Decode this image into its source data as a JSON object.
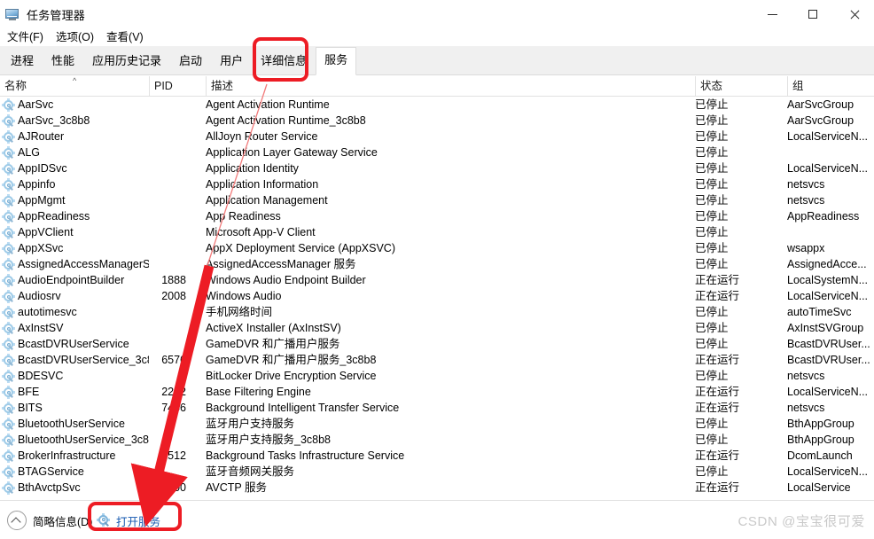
{
  "window": {
    "title": "任务管理器",
    "icon": "task-manager-icon",
    "controls": {
      "minimize": "最小化",
      "maximize": "最大化",
      "close": "关闭"
    }
  },
  "menu": {
    "items": [
      {
        "label": "文件(F)"
      },
      {
        "label": "选项(O)"
      },
      {
        "label": "查看(V)"
      }
    ]
  },
  "tabs": {
    "items": [
      {
        "label": "进程",
        "active": false
      },
      {
        "label": "性能",
        "active": false
      },
      {
        "label": "应用历史记录",
        "active": false
      },
      {
        "label": "启动",
        "active": false
      },
      {
        "label": "用户",
        "active": false
      },
      {
        "label": "详细信息",
        "active": false
      },
      {
        "label": "服务",
        "active": true
      }
    ]
  },
  "table": {
    "columns": [
      {
        "key": "name",
        "label": "名称",
        "sorted": "asc"
      },
      {
        "key": "pid",
        "label": "PID"
      },
      {
        "key": "desc",
        "label": "描述"
      },
      {
        "key": "state",
        "label": "状态"
      },
      {
        "key": "group",
        "label": "组"
      }
    ],
    "sort_indicator": "^",
    "rows": [
      {
        "name": "AarSvc",
        "pid": "",
        "desc": "Agent Activation Runtime",
        "state": "已停止",
        "group": "AarSvcGroup"
      },
      {
        "name": "AarSvc_3c8b8",
        "pid": "",
        "desc": "Agent Activation Runtime_3c8b8",
        "state": "已停止",
        "group": "AarSvcGroup"
      },
      {
        "name": "AJRouter",
        "pid": "",
        "desc": "AllJoyn Router Service",
        "state": "已停止",
        "group": "LocalServiceN..."
      },
      {
        "name": "ALG",
        "pid": "",
        "desc": "Application Layer Gateway Service",
        "state": "已停止",
        "group": ""
      },
      {
        "name": "AppIDSvc",
        "pid": "",
        "desc": "Application Identity",
        "state": "已停止",
        "group": "LocalServiceN..."
      },
      {
        "name": "Appinfo",
        "pid": "",
        "desc": "Application Information",
        "state": "已停止",
        "group": "netsvcs"
      },
      {
        "name": "AppMgmt",
        "pid": "",
        "desc": "Application Management",
        "state": "已停止",
        "group": "netsvcs"
      },
      {
        "name": "AppReadiness",
        "pid": "",
        "desc": "App Readiness",
        "state": "已停止",
        "group": "AppReadiness"
      },
      {
        "name": "AppVClient",
        "pid": "",
        "desc": "Microsoft App-V Client",
        "state": "已停止",
        "group": ""
      },
      {
        "name": "AppXSvc",
        "pid": "",
        "desc": "AppX Deployment Service (AppXSVC)",
        "state": "已停止",
        "group": "wsappx"
      },
      {
        "name": "AssignedAccessManagerS...",
        "pid": "",
        "desc": "AssignedAccessManager 服务",
        "state": "已停止",
        "group": "AssignedAcce..."
      },
      {
        "name": "AudioEndpointBuilder",
        "pid": "1888",
        "desc": "Windows Audio Endpoint Builder",
        "state": "正在运行",
        "group": "LocalSystemN..."
      },
      {
        "name": "Audiosrv",
        "pid": "2008",
        "desc": "Windows Audio",
        "state": "正在运行",
        "group": "LocalServiceN..."
      },
      {
        "name": "autotimesvc",
        "pid": "",
        "desc": "手机网络时间",
        "state": "已停止",
        "group": "autoTimeSvc"
      },
      {
        "name": "AxInstSV",
        "pid": "",
        "desc": "ActiveX Installer (AxInstSV)",
        "state": "已停止",
        "group": "AxInstSVGroup"
      },
      {
        "name": "BcastDVRUserService",
        "pid": "",
        "desc": "GameDVR 和广播用户服务",
        "state": "已停止",
        "group": "BcastDVRUser..."
      },
      {
        "name": "BcastDVRUserService_3c8...",
        "pid": "6576",
        "desc": "GameDVR 和广播用户服务_3c8b8",
        "state": "正在运行",
        "group": "BcastDVRUser..."
      },
      {
        "name": "BDESVC",
        "pid": "",
        "desc": "BitLocker Drive Encryption Service",
        "state": "已停止",
        "group": "netsvcs"
      },
      {
        "name": "BFE",
        "pid": "2252",
        "desc": "Base Filtering Engine",
        "state": "正在运行",
        "group": "LocalServiceN..."
      },
      {
        "name": "BITS",
        "pid": "7456",
        "desc": "Background Intelligent Transfer Service",
        "state": "正在运行",
        "group": "netsvcs"
      },
      {
        "name": "BluetoothUserService",
        "pid": "",
        "desc": "蓝牙用户支持服务",
        "state": "已停止",
        "group": "BthAppGroup"
      },
      {
        "name": "BluetoothUserService_3c8...",
        "pid": "",
        "desc": "蓝牙用户支持服务_3c8b8",
        "state": "已停止",
        "group": "BthAppGroup"
      },
      {
        "name": "BrokerInfrastructure",
        "pid": "1512",
        "desc": "Background Tasks Infrastructure Service",
        "state": "正在运行",
        "group": "DcomLaunch"
      },
      {
        "name": "BTAGService",
        "pid": "",
        "desc": "蓝牙音频网关服务",
        "state": "已停止",
        "group": "LocalServiceN..."
      },
      {
        "name": "BthAvctpSvc",
        "pid": "8700",
        "desc": "AVCTP 服务",
        "state": "正在运行",
        "group": "LocalService"
      }
    ]
  },
  "bottom": {
    "fewer_details_label": "简略信息(D)",
    "fewer_details_icon": "chevron-up-circle-icon",
    "open_services_label": "打开服务",
    "open_services_icon": "services-gear-icon"
  },
  "watermark": {
    "text": "CSDN @宝宝很可爱"
  },
  "annotations": {
    "accent_color": "#ed1c24",
    "tab_highlight_target": "服务",
    "button_highlight_target": "打开服务",
    "arrow": "red-arrow-from-services-tab-to-open-services-button"
  }
}
